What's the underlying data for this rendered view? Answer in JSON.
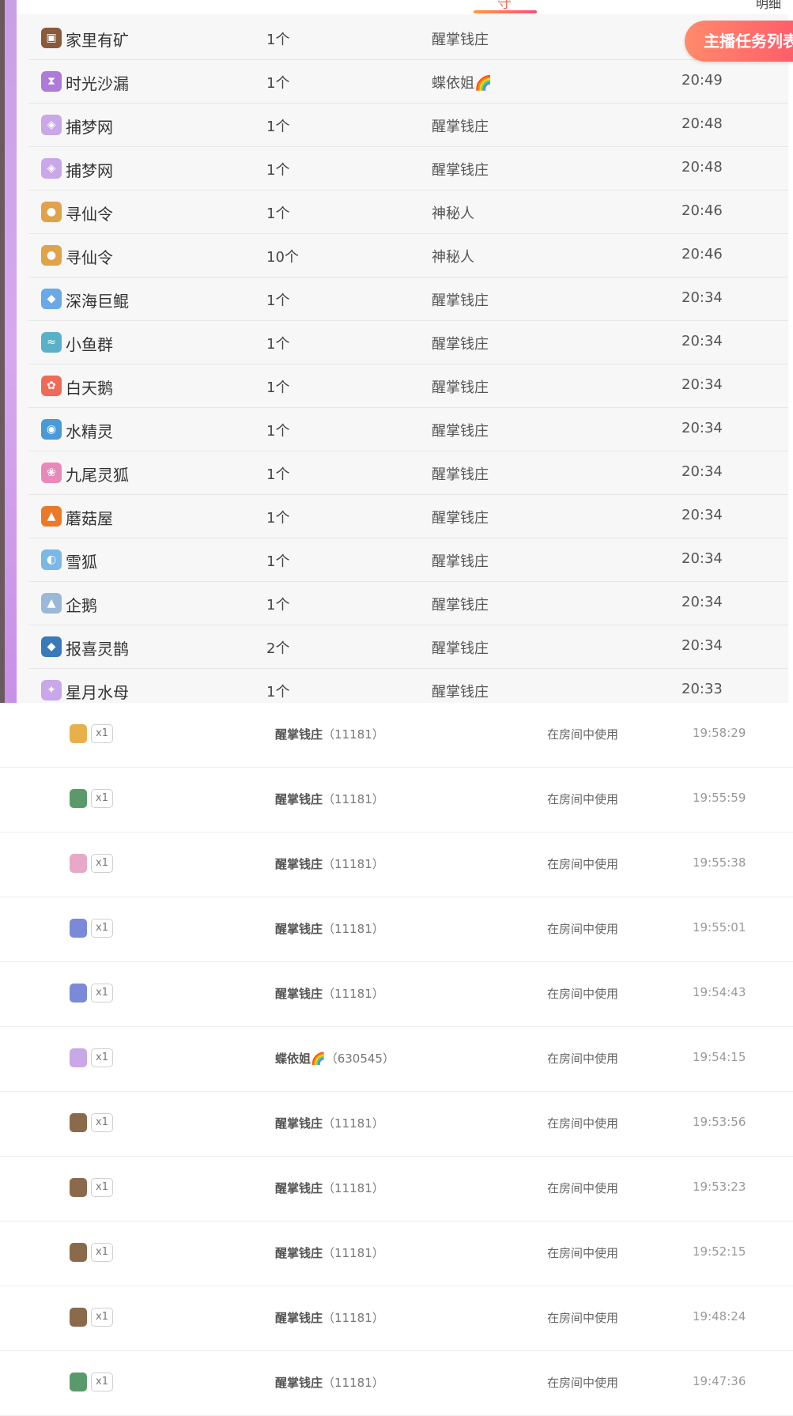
{
  "header": {
    "active_tab_glyph": "守",
    "right_tab_label": "明细",
    "task_button_label": "主播任务列表"
  },
  "gifts": [
    {
      "icon": "treasure-chest-icon",
      "color": "#8a5a3a",
      "name": "家里有矿",
      "qty": "1个",
      "sender": "醒掌钱庄",
      "time": ""
    },
    {
      "icon": "hourglass-icon",
      "color": "#b07ad8",
      "name": "时光沙漏",
      "qty": "1个",
      "sender": "蝶依姐🌈",
      "time": "20:49"
    },
    {
      "icon": "dreamcatcher-icon",
      "color": "#c9a8e8",
      "name": "捕梦网",
      "qty": "1个",
      "sender": "醒掌钱庄",
      "time": "20:48"
    },
    {
      "icon": "dreamcatcher-icon",
      "color": "#c9a8e8",
      "name": "捕梦网",
      "qty": "1个",
      "sender": "醒掌钱庄",
      "time": "20:48"
    },
    {
      "icon": "token-icon",
      "color": "#e0a24a",
      "name": "寻仙令",
      "qty": "1个",
      "sender": "神秘人",
      "time": "20:46"
    },
    {
      "icon": "token-icon",
      "color": "#e0a24a",
      "name": "寻仙令",
      "qty": "10个",
      "sender": "神秘人",
      "time": "20:46"
    },
    {
      "icon": "whale-icon",
      "color": "#6aa8e8",
      "name": "深海巨鲲",
      "qty": "1个",
      "sender": "醒掌钱庄",
      "time": "20:34"
    },
    {
      "icon": "fish-school-icon",
      "color": "#5ab0c8",
      "name": "小鱼群",
      "qty": "1个",
      "sender": "醒掌钱庄",
      "time": "20:34"
    },
    {
      "icon": "swan-icon",
      "color": "#f06a5a",
      "name": "白天鹅",
      "qty": "1个",
      "sender": "醒掌钱庄",
      "time": "20:34"
    },
    {
      "icon": "water-spirit-icon",
      "color": "#4a9ad8",
      "name": "水精灵",
      "qty": "1个",
      "sender": "醒掌钱庄",
      "time": "20:34"
    },
    {
      "icon": "fox-icon",
      "color": "#e88ab8",
      "name": "九尾灵狐",
      "qty": "1个",
      "sender": "醒掌钱庄",
      "time": "20:34"
    },
    {
      "icon": "mushroom-house-icon",
      "color": "#e87a2a",
      "name": "蘑菇屋",
      "qty": "1个",
      "sender": "醒掌钱庄",
      "time": "20:34"
    },
    {
      "icon": "snow-fox-icon",
      "color": "#7ab8e8",
      "name": "雪狐",
      "qty": "1个",
      "sender": "醒掌钱庄",
      "time": "20:34"
    },
    {
      "icon": "penguin-icon",
      "color": "#9ab8d8",
      "name": "企鹅",
      "qty": "1个",
      "sender": "醒掌钱庄",
      "time": "20:34"
    },
    {
      "icon": "magpie-icon",
      "color": "#3a7ab8",
      "name": "报喜灵鹊",
      "qty": "2个",
      "sender": "醒掌钱庄",
      "time": "20:34"
    },
    {
      "icon": "jellyfish-icon",
      "color": "#c8a8e8",
      "name": "星月水母",
      "qty": "1个",
      "sender": "醒掌钱庄",
      "time": "20:33"
    }
  ],
  "usage_log": [
    {
      "icon": "boat-icon",
      "color": "#e8b04a",
      "count": "x1",
      "user": "醒掌钱庄",
      "uid": "（11181）",
      "action": "在房间中使用",
      "time": "19:58:29"
    },
    {
      "icon": "tree-icon",
      "color": "#5a9a6a",
      "count": "x1",
      "user": "醒掌钱庄",
      "uid": "（11181）",
      "action": "在房间中使用",
      "time": "19:55:59"
    },
    {
      "icon": "flower-fairy-icon",
      "color": "#e8a8c8",
      "count": "x1",
      "user": "醒掌钱庄",
      "uid": "（11181）",
      "action": "在房间中使用",
      "time": "19:55:38"
    },
    {
      "icon": "castle-icon",
      "color": "#7a8ad8",
      "count": "x1",
      "user": "醒掌钱庄",
      "uid": "（11181）",
      "action": "在房间中使用",
      "time": "19:55:01"
    },
    {
      "icon": "castle-icon",
      "color": "#7a8ad8",
      "count": "x1",
      "user": "醒掌钱庄",
      "uid": "（11181）",
      "action": "在房间中使用",
      "time": "19:54:43"
    },
    {
      "icon": "dreamcatcher-icon",
      "color": "#c9a8e8",
      "count": "x1",
      "user": "蝶依姐🌈",
      "uid": "（630545）",
      "action": "在房间中使用",
      "time": "19:54:15"
    },
    {
      "icon": "treasure-chest-icon",
      "color": "#8a6a4a",
      "count": "x1",
      "user": "醒掌钱庄",
      "uid": "（11181）",
      "action": "在房间中使用",
      "time": "19:53:56"
    },
    {
      "icon": "treasure-chest-icon",
      "color": "#8a6a4a",
      "count": "x1",
      "user": "醒掌钱庄",
      "uid": "（11181）",
      "action": "在房间中使用",
      "time": "19:53:23"
    },
    {
      "icon": "treasure-chest-icon",
      "color": "#8a6a4a",
      "count": "x1",
      "user": "醒掌钱庄",
      "uid": "（11181）",
      "action": "在房间中使用",
      "time": "19:52:15"
    },
    {
      "icon": "treasure-chest-icon",
      "color": "#8a6a4a",
      "count": "x1",
      "user": "醒掌钱庄",
      "uid": "（11181）",
      "action": "在房间中使用",
      "time": "19:48:24"
    },
    {
      "icon": "tree-icon",
      "color": "#5a9a6a",
      "count": "x1",
      "user": "醒掌钱庄",
      "uid": "（11181）",
      "action": "在房间中使用",
      "time": "19:47:36"
    }
  ]
}
